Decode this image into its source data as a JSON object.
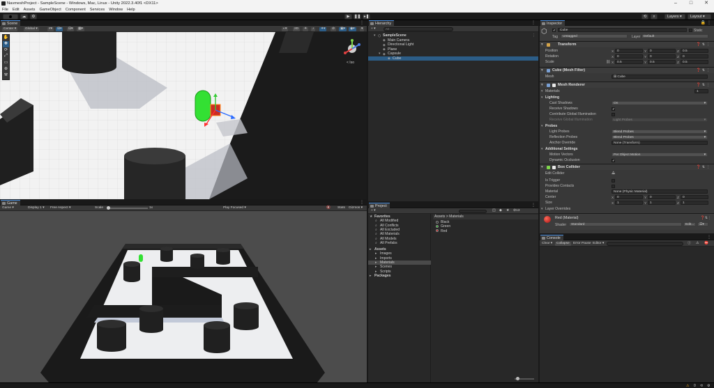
{
  "window": {
    "title": "NavmeshProject - SampleScene - Windows, Mac, Linux - Unity 2022.3.40f1 <DX11>",
    "minimize": "–",
    "maximize": "□",
    "close": "✕"
  },
  "menu": [
    "File",
    "Edit",
    "Assets",
    "GameObject",
    "Component",
    "Services",
    "Window",
    "Help"
  ],
  "toolbar": {
    "account": "AC",
    "layers": "Layers",
    "layout": "Layout"
  },
  "scene": {
    "tab": "Scene",
    "pivot": "Center",
    "space": "Global",
    "mode_2d": "2D",
    "view_label": "< Iso"
  },
  "game": {
    "tab": "Game",
    "display_mode": "Game",
    "display": "Display 1",
    "aspect": "Free Aspect",
    "scale_label": "Scale",
    "scale_value": "1x",
    "play_mode": "Play Focused",
    "stats": "Stats",
    "gizmos": "Gizmos"
  },
  "hierarchy": {
    "tab": "Hierarchy",
    "search_placeholder": "All",
    "items": [
      {
        "label": "SampleScene",
        "indent": 0
      },
      {
        "label": "Main Camera",
        "indent": 1
      },
      {
        "label": "Directional Light",
        "indent": 1
      },
      {
        "label": "Plane",
        "indent": 1
      },
      {
        "label": "Capsule",
        "indent": 1
      },
      {
        "label": "Cube",
        "indent": 2,
        "selected": true
      }
    ]
  },
  "project": {
    "tab": "Project",
    "favorites_label": "Favorites",
    "favorites": [
      "All Modified",
      "All Conflicts",
      "All Excluded",
      "All Materials",
      "All Models",
      "All Prefabs"
    ],
    "assets_label": "Assets",
    "folders": [
      "Images",
      "Imports",
      "Materials",
      "Scenes",
      "Scripts"
    ],
    "packages_label": "Packages",
    "breadcrumb": "Assets > Materials",
    "files": [
      "Black",
      "Green",
      "Red"
    ],
    "file_colors": [
      "#1a1a1a",
      "#20c020",
      "#d02020"
    ],
    "hidden_count": "13"
  },
  "inspector": {
    "tab": "Inspector",
    "object_name": "Cube",
    "static_label": "Static",
    "tag_label": "Tag",
    "tag_value": "Untagged",
    "layer_label": "Layer",
    "layer_value": "Default",
    "transform": {
      "title": "Transform",
      "position": {
        "label": "Position",
        "x": "0",
        "y": "0",
        "z": "0.5"
      },
      "rotation": {
        "label": "Rotation",
        "x": "0",
        "y": "0",
        "z": "0"
      },
      "scale": {
        "label": "Scale",
        "x": "0.5",
        "y": "0.5",
        "z": "0.5"
      }
    },
    "mesh_filter": {
      "title": "Cube (Mesh Filter)",
      "mesh_label": "Mesh",
      "mesh_value": "Cube"
    },
    "mesh_renderer": {
      "title": "Mesh Renderer",
      "materials_label": "Materials",
      "materials_count": "1",
      "lighting_label": "Lighting",
      "cast_shadows_label": "Cast Shadows",
      "cast_shadows_value": "On",
      "receive_shadows_label": "Receive Shadows",
      "contribute_gi_label": "Contribute Global Illumination",
      "receive_gi_label": "Receive Global Illumination",
      "receive_gi_value": "Light Probes",
      "probes_label": "Probes",
      "light_probes_label": "Light Probes",
      "light_probes_value": "Blend Probes",
      "reflection_probes_label": "Reflection Probes",
      "reflection_probes_value": "Blend Probes",
      "anchor_override_label": "Anchor Override",
      "anchor_override_value": "None (Transform)",
      "additional_label": "Additional Settings",
      "motion_vectors_label": "Motion Vectors",
      "motion_vectors_value": "Per Object Motion",
      "dynamic_occlusion_label": "Dynamic Occlusion"
    },
    "box_collider": {
      "title": "Box Collider",
      "edit_collider_label": "Edit Collider",
      "is_trigger_label": "Is Trigger",
      "provides_contacts_label": "Provides Contacts",
      "material_label": "Material",
      "material_value": "None (Physic Material)",
      "center": {
        "label": "Center",
        "x": "0",
        "y": "0",
        "z": "0"
      },
      "size": {
        "label": "Size",
        "x": "1",
        "y": "1",
        "z": "1"
      },
      "layer_overrides_label": "Layer Overrides"
    },
    "material": {
      "title": "Red (Material)",
      "shader_label": "Shader",
      "shader_value": "Standard",
      "edit_label": "Edit..."
    }
  },
  "console": {
    "tab": "Console",
    "clear": "Clear",
    "collapse": "Collapse",
    "error_pause": "Error Pause",
    "editor": "Editor"
  },
  "status": {
    "badge": "0"
  },
  "colors": {
    "accent": "#4a8fe0",
    "selection": "#2c5d87",
    "play_green": "#00cc00",
    "capsule_green": "#33e033",
    "cube_red": "#cc2b22"
  }
}
